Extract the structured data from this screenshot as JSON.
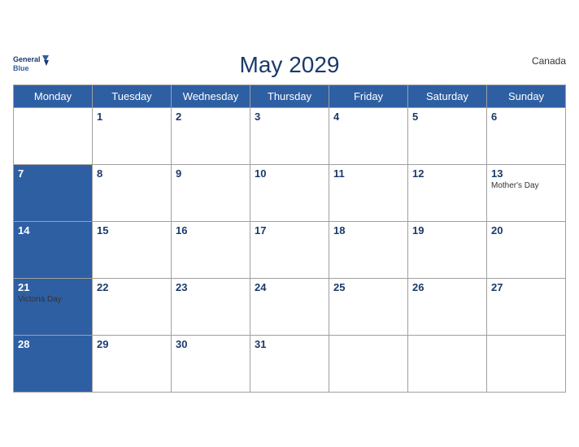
{
  "header": {
    "title": "May 2029",
    "country": "Canada",
    "logo_general": "General",
    "logo_blue": "Blue"
  },
  "weekdays": [
    "Monday",
    "Tuesday",
    "Wednesday",
    "Thursday",
    "Friday",
    "Saturday",
    "Sunday"
  ],
  "weeks": [
    [
      {
        "day": "",
        "empty": true
      },
      {
        "day": "1"
      },
      {
        "day": "2"
      },
      {
        "day": "3"
      },
      {
        "day": "4"
      },
      {
        "day": "5"
      },
      {
        "day": "6"
      }
    ],
    [
      {
        "day": "7"
      },
      {
        "day": "8"
      },
      {
        "day": "9"
      },
      {
        "day": "10"
      },
      {
        "day": "11"
      },
      {
        "day": "12"
      },
      {
        "day": "13",
        "event": "Mother's Day"
      }
    ],
    [
      {
        "day": "14"
      },
      {
        "day": "15"
      },
      {
        "day": "16"
      },
      {
        "day": "17"
      },
      {
        "day": "18"
      },
      {
        "day": "19"
      },
      {
        "day": "20"
      }
    ],
    [
      {
        "day": "21",
        "event": "Victoria Day"
      },
      {
        "day": "22"
      },
      {
        "day": "23"
      },
      {
        "day": "24"
      },
      {
        "day": "25"
      },
      {
        "day": "26"
      },
      {
        "day": "27"
      }
    ],
    [
      {
        "day": "28"
      },
      {
        "day": "29"
      },
      {
        "day": "30"
      },
      {
        "day": "31"
      },
      {
        "day": ""
      },
      {
        "day": ""
      },
      {
        "day": ""
      }
    ]
  ],
  "colors": {
    "header_bg": "#2e5fa3",
    "title_color": "#1a3a6b",
    "text_white": "#ffffff"
  }
}
